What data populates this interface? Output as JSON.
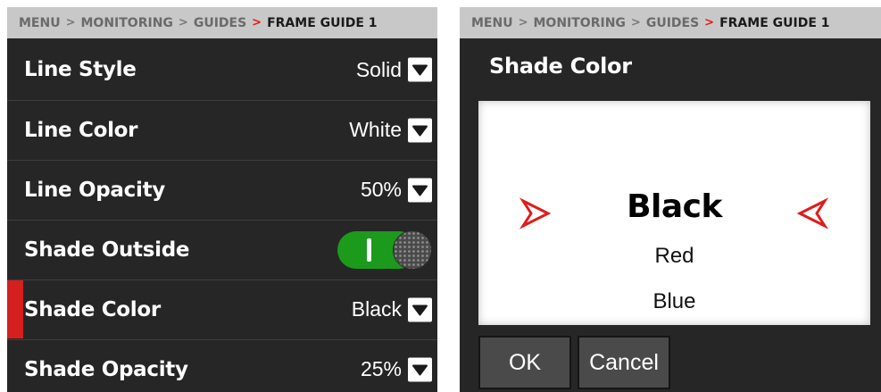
{
  "left": {
    "breadcrumb": {
      "items": [
        "MENU",
        "MONITORING",
        "GUIDES",
        "FRAME GUIDE 1"
      ],
      "sep": ">"
    },
    "rows": [
      {
        "label": "Line Style",
        "value": "Solid",
        "type": "dropdown"
      },
      {
        "label": "Line Color",
        "value": "White",
        "type": "dropdown"
      },
      {
        "label": "Line Opacity",
        "value": "50%",
        "type": "dropdown"
      },
      {
        "label": "Shade Outside",
        "value": "on",
        "type": "toggle"
      },
      {
        "label": "Shade Color",
        "value": "Black",
        "type": "dropdown",
        "selected": true
      },
      {
        "label": "Shade Opacity",
        "value": "25%",
        "type": "dropdown"
      }
    ]
  },
  "right": {
    "breadcrumb": {
      "items": [
        "MENU",
        "MONITORING",
        "GUIDES",
        "FRAME GUIDE 1"
      ],
      "sep": ">"
    },
    "title": "Shade Color",
    "picker": {
      "selected": "Black",
      "options_below": [
        "Red",
        "Blue"
      ]
    },
    "buttons": {
      "ok": "OK",
      "cancel": "Cancel"
    }
  },
  "colors": {
    "accent_red": "#e01b1b",
    "toggle_green": "#1c9a1c",
    "panel_bg": "#262626",
    "breadcrumb_bg": "#c8c8c8"
  },
  "icons": [
    "chevron-down-icon",
    "arrow-right-icon",
    "arrow-left-icon",
    "separator-chevron-icon"
  ]
}
